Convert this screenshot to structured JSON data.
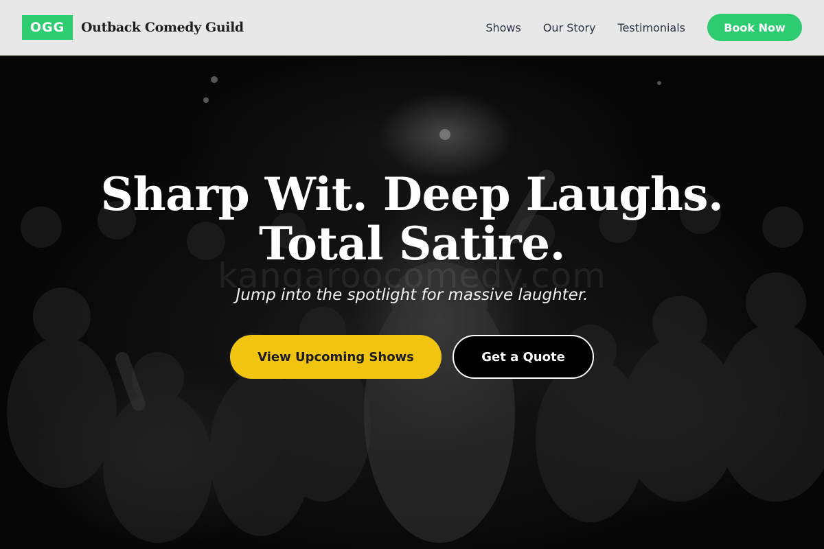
{
  "header": {
    "logo_text": "OGG",
    "brand_name": "Outback Comedy Guild",
    "nav": [
      {
        "label": "Shows"
      },
      {
        "label": "Our Story"
      },
      {
        "label": "Testimonials"
      }
    ],
    "cta_label": "Book Now"
  },
  "hero": {
    "headline_line1": "Sharp Wit. Deep Laughs.",
    "headline_line2": "Total Satire.",
    "subhead": "Jump into the spotlight for massive laughter.",
    "watermark": "kangaroocomedy.com",
    "primary_button": "View Upcoming Shows",
    "secondary_button": "Get a Quote",
    "background_image": "black-and-white photo of a cheering concert crowd around a performer"
  },
  "colors": {
    "accent_green": "#2ecc71",
    "accent_yellow": "#f1c40f",
    "header_bg": "#e8e8e8",
    "nav_text": "#2b3340"
  }
}
